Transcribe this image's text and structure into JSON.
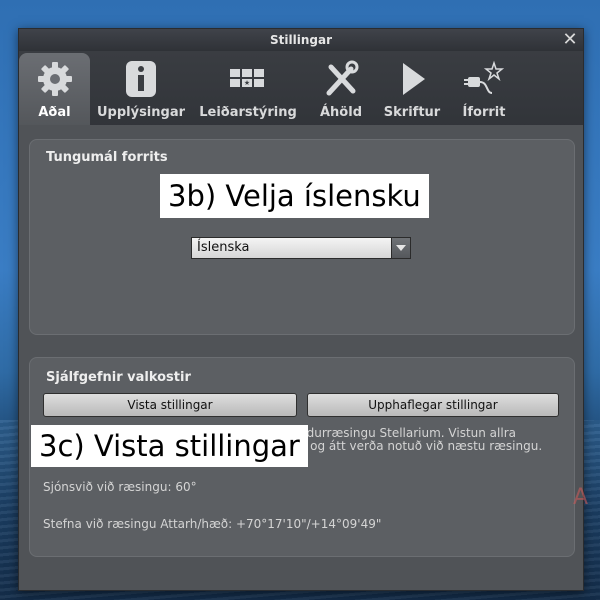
{
  "window": {
    "title": "Stillingar"
  },
  "toolbar": {
    "tabs": [
      {
        "label": "Aðal",
        "icon": "gear-icon",
        "active": true
      },
      {
        "label": "Upplýsingar",
        "icon": "info-icon",
        "active": false
      },
      {
        "label": "Leiðarstýring",
        "icon": "keyboard-icon",
        "active": false
      },
      {
        "label": "Áhöld",
        "icon": "tools-icon",
        "active": false
      },
      {
        "label": "Skriftur",
        "icon": "play-icon",
        "active": false
      },
      {
        "label": "Íforrit",
        "icon": "plugin-icon",
        "active": false
      }
    ]
  },
  "language_group": {
    "title": "Tungumál forrits",
    "select_value": "Íslenska"
  },
  "defaults_group": {
    "title": "Sjálfgefnir valkostir",
    "save_button": "Vista stillingar",
    "restore_button": "Upphaflegar stillingar",
    "info_line1": "ndurræsingu Stellarium. Vistun allra",
    "info_line2": "ð og átt verða notuð við næstu ræsingu.",
    "fov_text": "Sjónsvið við ræsingu: 60°",
    "direction_text": "Stefna við ræsingu Attarh/hæð: +70°17'10\"/+14°09'49\""
  },
  "annotations": {
    "step_3b": "3b) Velja íslensku",
    "step_3c": "3c) Vista stillingar"
  },
  "colors": {
    "sky": "#3a7dc4",
    "dialog_bg": "#505357",
    "group_bg": "#5c5f63"
  }
}
